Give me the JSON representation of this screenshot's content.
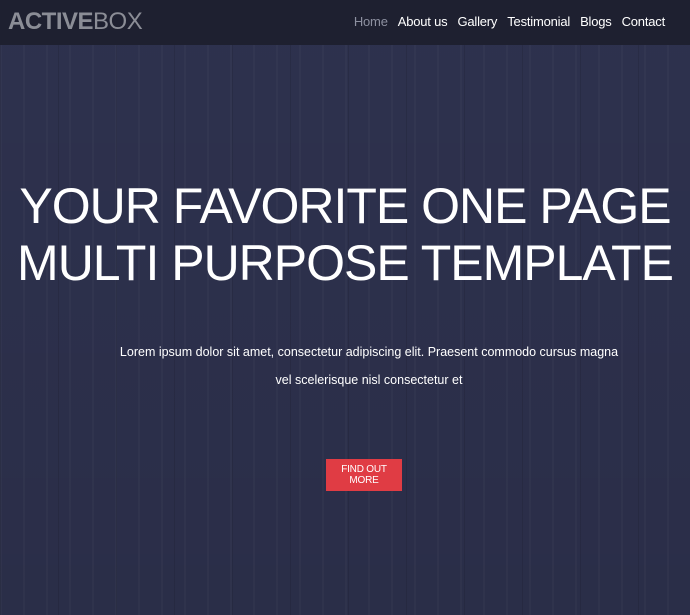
{
  "brand": {
    "logo_bold": "ACTIVE",
    "logo_light": "BOX"
  },
  "nav": {
    "items": [
      {
        "label": "Home",
        "active": true
      },
      {
        "label": "About us"
      },
      {
        "label": "Gallery"
      },
      {
        "label": "Testimonial"
      },
      {
        "label": "Blogs"
      },
      {
        "label": "Contact"
      }
    ]
  },
  "hero": {
    "headline_line1": "YOUR FAVORITE ONE PAGE",
    "headline_line2": "MULTI PURPOSE TEMPLATE",
    "body_line1": "Lorem ipsum dolor sit amet, consectetur adipiscing elit. Praesent commodo cursus magna",
    "body_line2": "vel scelerisque nisl consectetur et",
    "cta_label": "FIND OUT MORE"
  },
  "colors": {
    "background": "#303452",
    "navbar": "#1e2030",
    "accent": "#e03c44"
  }
}
